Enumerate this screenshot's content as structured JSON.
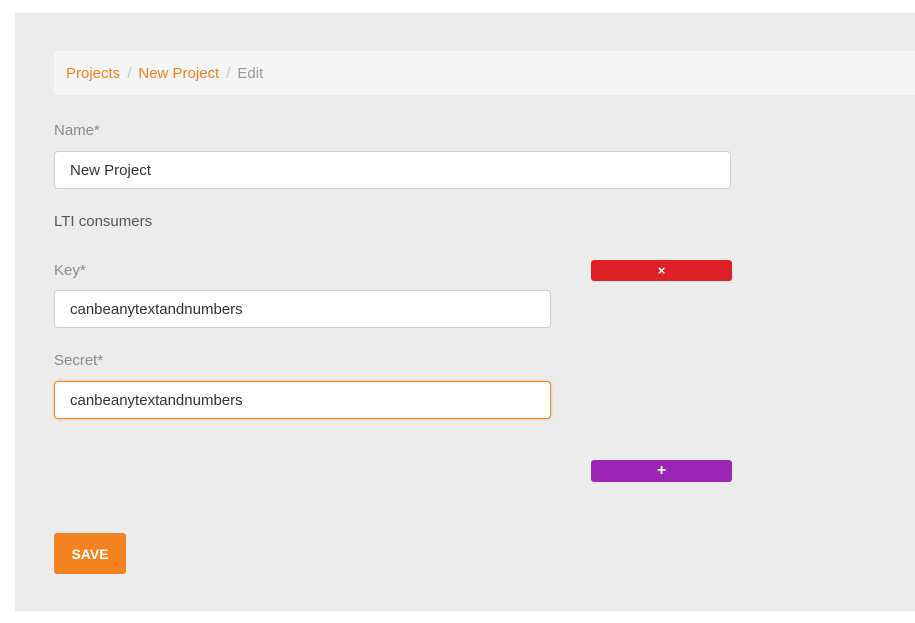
{
  "breadcrumb": {
    "items": [
      {
        "label": "Projects"
      },
      {
        "label": "New Project"
      }
    ],
    "separator": "/",
    "current": "Edit"
  },
  "form": {
    "name_label": "Name*",
    "name_value": "New Project",
    "lti_label": "LTI consumers",
    "key_label": "Key*",
    "key_value": "canbeanytextandnumbers",
    "secret_label": "Secret*",
    "secret_value": "canbeanytextandnumbers",
    "remove_icon": "×",
    "add_icon": "+",
    "save_label": "SAVE"
  },
  "colors": {
    "accent": "#f58220",
    "remove": "#e02027",
    "add": "#9b26b6",
    "panel_bg": "#ececec"
  }
}
